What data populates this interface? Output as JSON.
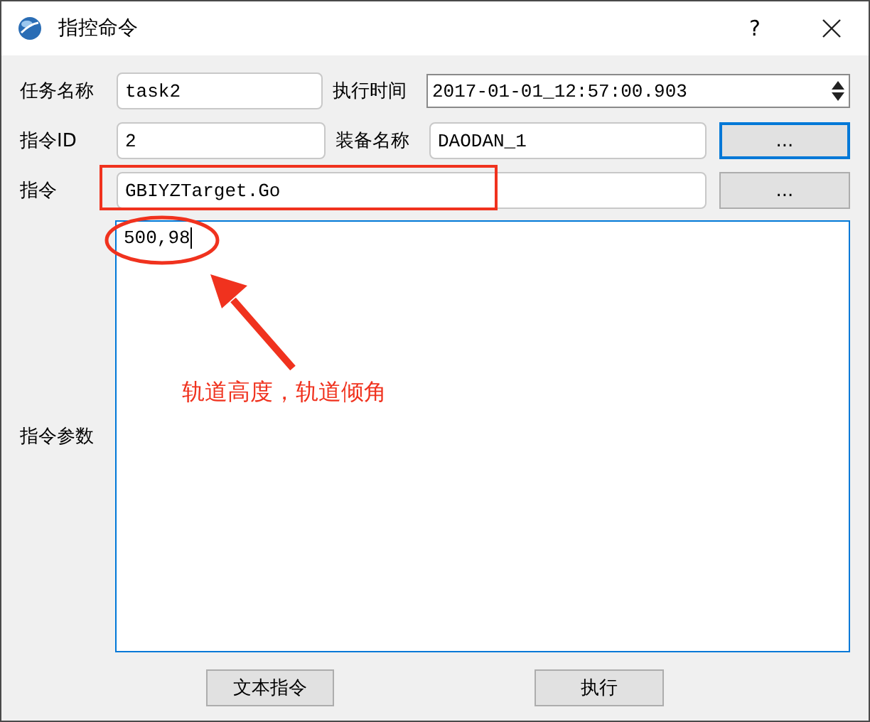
{
  "window": {
    "title": "指控命令",
    "help": "?"
  },
  "task_name": {
    "label": "任务名称",
    "value": "task2"
  },
  "exec_time": {
    "label": "执行时间",
    "value": "2017-01-01_12:57:00.903"
  },
  "command_id": {
    "label": "指令ID",
    "value": "2"
  },
  "equipment_name": {
    "label": "装备名称",
    "value": "DAODAN_1",
    "browse": {
      "label": "...",
      "focused": true
    }
  },
  "command": {
    "label": "指令",
    "value": "GBIYZTarget.Go",
    "browse": {
      "label": "...",
      "focused": false
    }
  },
  "params": {
    "label": "指令参数",
    "value": "500,98"
  },
  "buttons": [
    "文本指令",
    "执行"
  ],
  "annotation": {
    "text": "轨道高度，轨道倾角"
  }
}
